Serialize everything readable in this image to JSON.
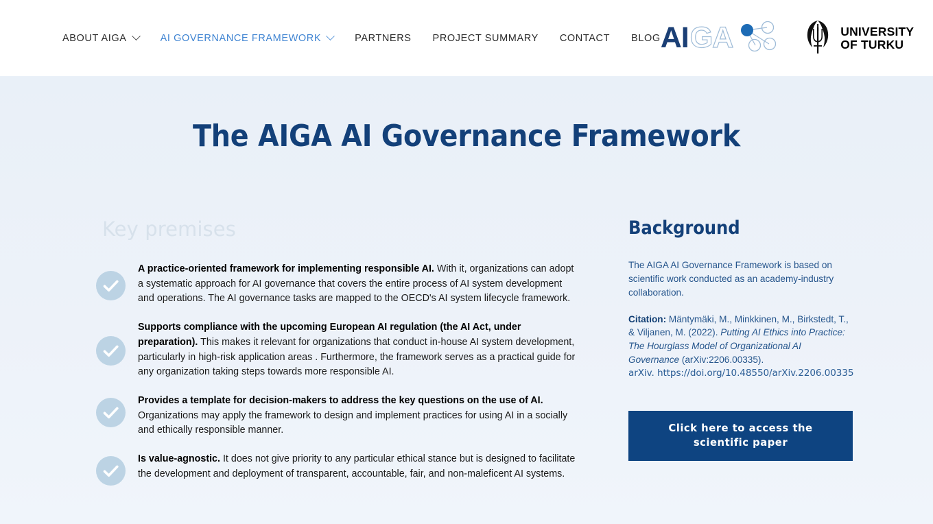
{
  "header": {
    "nav": [
      {
        "label": "ABOUT AIGA",
        "has_dropdown": true,
        "active": false,
        "icon": "chevron-down-icon"
      },
      {
        "label": "AI GOVERNANCE FRAMEWORK",
        "has_dropdown": true,
        "active": true,
        "icon": "chevron-down-icon"
      },
      {
        "label": "PARTNERS",
        "has_dropdown": false,
        "active": false
      },
      {
        "label": "PROJECT SUMMARY",
        "has_dropdown": false,
        "active": false
      },
      {
        "label": "CONTACT",
        "has_dropdown": false,
        "active": false
      },
      {
        "label": "BLOG",
        "has_dropdown": false,
        "active": false
      }
    ],
    "logos": {
      "aiga": {
        "part_solid": "AI",
        "part_outline": "GA",
        "graphic": "network-nodes-icon"
      },
      "turku": {
        "line1": "UNIVERSITY",
        "line2": "OF TURKU",
        "crest": "turku-crest-icon"
      }
    }
  },
  "hero": {
    "title": "The AIGA AI Governance Framework"
  },
  "premises": {
    "heading": "Key premises",
    "items": [
      {
        "icon": "check-circle-icon",
        "lead": "A practice-oriented framework for implementing responsible AI.",
        "body": " With it, organizations can adopt a systematic approach for AI governance that covers the entire process of AI system development and operations. The AI governance tasks are mapped to the OECD's AI system lifecycle framework."
      },
      {
        "icon": "check-circle-icon",
        "lead": "Supports compliance with the upcoming European AI regulation (the AI Act, under preparation).",
        "body": " This makes it relevant for organizations that conduct in-house AI system development, particularly in high-risk application areas . Furthermore, the framework serves as a practical guide for any organization taking steps towards more responsible AI."
      },
      {
        "icon": "check-circle-icon",
        "lead": "Provides a template for decision-makers to address the key questions on the use of AI.",
        "body": " Organizations may apply the framework to design and implement practices for using AI in a socially and ethically responsible manner."
      },
      {
        "icon": "check-circle-icon",
        "lead": "Is value-agnostic.",
        "body": " It does not give priority to any particular ethical stance but is designed to facilitate the development and deployment of transparent, accountable, fair, and non-maleficent AI systems."
      }
    ]
  },
  "background": {
    "heading": "Background",
    "paragraph": "The AIGA AI Governance Framework is based on scientific work conducted as an academy-industry collaboration.",
    "citation": {
      "label": "Citation:",
      "authors_before": " Mäntymäki, M., Minkkinen, M., Birkstedt, T., & Viljanen, M. (2022). ",
      "work_title_italic": "Putting AI Ethics into Practice: The Hourglass Model of Organizational AI Governance",
      "after": " (arXiv:2206.00335).",
      "link": "arXiv. https://doi.org/10.48550/arXiv.2206.00335"
    },
    "cta": {
      "line1": "Click here to access the",
      "line2": "scientific paper"
    }
  },
  "colors": {
    "page_bg": "#eaf0f8",
    "header_bg": "#ffffff",
    "brand_navy": "#134079",
    "accent_blue": "#3f84d2",
    "cta_bg": "#0e4481",
    "check_circle": "#bcd3e4",
    "faded_heading": "#d7e1eb",
    "body_text": "#1a1a1a",
    "right_text": "#25558c"
  }
}
